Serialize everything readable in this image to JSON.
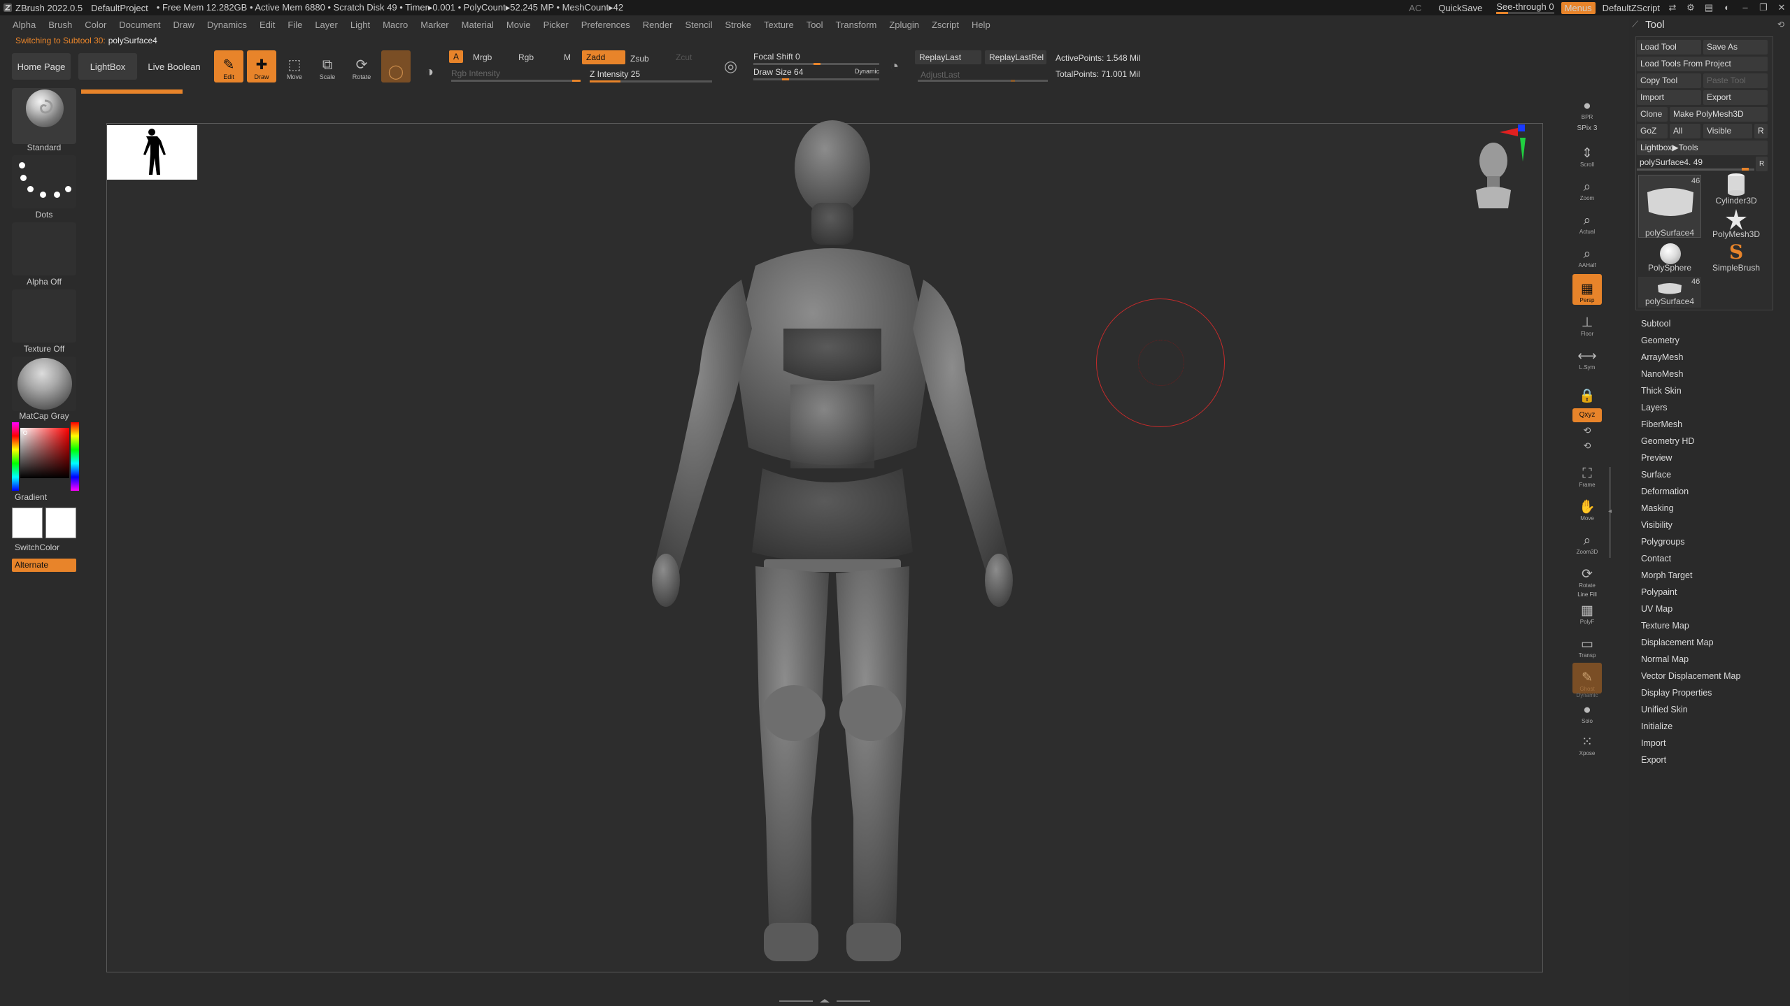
{
  "titlebar": {
    "app": "ZBrush 2022.0.5",
    "project": "DefaultProject",
    "stats": "• Free Mem 12.282GB • Active Mem 6880 • Scratch Disk 49 •  Timer▸0.001 • PolyCount▸52.245 MP  • MeshCount▸42",
    "ac": "AC",
    "quicksave": "QuickSave",
    "seethrough": "See-through  0",
    "seethrough_value": 0,
    "menus": "Menus",
    "script": "DefaultZScript",
    "accent": "#e8842a"
  },
  "menubar": [
    "Alpha",
    "Brush",
    "Color",
    "Document",
    "Draw",
    "Dynamics",
    "Edit",
    "File",
    "Layer",
    "Light",
    "Macro",
    "Marker",
    "Material",
    "Movie",
    "Picker",
    "Preferences",
    "Render",
    "Stencil",
    "Stroke",
    "Texture",
    "Tool",
    "Transform",
    "Zplugin",
    "Zscript",
    "Help"
  ],
  "notice": {
    "label": "Switching to Subtool 30:",
    "value": "polySurface4"
  },
  "shelf": {
    "home": "Home Page",
    "lightbox": "LightBox",
    "live_boolean": "Live Boolean",
    "edit": "Edit",
    "draw": "Draw",
    "move": "Move",
    "scale": "Scale",
    "rotate": "Rotate",
    "a": "A",
    "mrgb": "Mrgb",
    "rgb": "Rgb",
    "m": "M",
    "zadd": "Zadd",
    "zsub": "Zsub",
    "zcut": "Zcut",
    "rgb_intensity": "Rgb Intensity",
    "z_intensity": "Z Intensity 25",
    "z_intensity_value": 25,
    "focal_shift": "Focal Shift 0",
    "focal_shift_value": 0,
    "draw_size": "Draw Size 64",
    "draw_size_value": 64,
    "dynamic": "Dynamic",
    "replay_last": "ReplayLast",
    "replay_last_rel": "ReplayLastRel",
    "adjust_last": "AdjustLast",
    "active_points": "ActivePoints: 1.548 Mil",
    "total_points": "TotalPoints: 71.001 Mil"
  },
  "left_palette": {
    "brush": "Standard",
    "stroke": "Dots",
    "alpha": "Alpha Off",
    "texture": "Texture Off",
    "material": "MatCap Gray",
    "gradient": "Gradient",
    "switch_color": "SwitchColor",
    "alternate": "Alternate"
  },
  "right_shelf": {
    "bpr": "BPR",
    "spix": "SPix 3",
    "scroll": "Scroll",
    "zoom": "Zoom",
    "actual": "Actual",
    "aahalf": "AAHalf",
    "persp": "Persp",
    "floor": "Floor",
    "lsym": "L.Sym",
    "lock": "",
    "xyz": "Qxyz",
    "frame": "Frame",
    "move": "Move",
    "zoom3d": "Zoom3D",
    "rotate": "Rotate",
    "line_fill": "Line Fill",
    "polyf": "PolyF",
    "transp": "Transp",
    "ghost": "Ghost",
    "dynamic": "Dynamic",
    "solo": "Solo",
    "xpose": "Xpose"
  },
  "tool_panel": {
    "title": "Tool",
    "load_tool": "Load Tool",
    "save_as": "Save As",
    "load_from_project": "Load Tools From Project",
    "copy_tool": "Copy Tool",
    "paste_tool": "Paste Tool",
    "import": "Import",
    "export": "Export",
    "clone": "Clone",
    "make_polymesh": "Make PolyMesh3D",
    "goz": "GoZ",
    "all": "All",
    "visible": "Visible",
    "r": "R",
    "lightbox_tools": "Lightbox▶Tools",
    "current_tool": "polySurface4. 49",
    "current_tool_r": "R",
    "tools": [
      {
        "name": "polySurface4",
        "count": "46"
      },
      {
        "name": "Cylinder3D",
        "count": ""
      },
      {
        "name": "PolyMesh3D",
        "count": ""
      },
      {
        "name": "PolySphere",
        "count": ""
      },
      {
        "name": "SimpleBrush",
        "count": ""
      },
      {
        "name": "polySurface4",
        "count": "46"
      }
    ],
    "subpalettes": [
      "Subtool",
      "Geometry",
      "ArrayMesh",
      "NanoMesh",
      "Thick Skin",
      "Layers",
      "FiberMesh",
      "Geometry HD",
      "Preview",
      "Surface",
      "Deformation",
      "Masking",
      "Visibility",
      "Polygroups",
      "Contact",
      "Morph Target",
      "Polypaint",
      "UV Map",
      "Texture Map",
      "Displacement Map",
      "Normal Map",
      "Vector Displacement Map",
      "Display Properties",
      "Unified Skin",
      "Initialize",
      "Import",
      "Export"
    ]
  }
}
